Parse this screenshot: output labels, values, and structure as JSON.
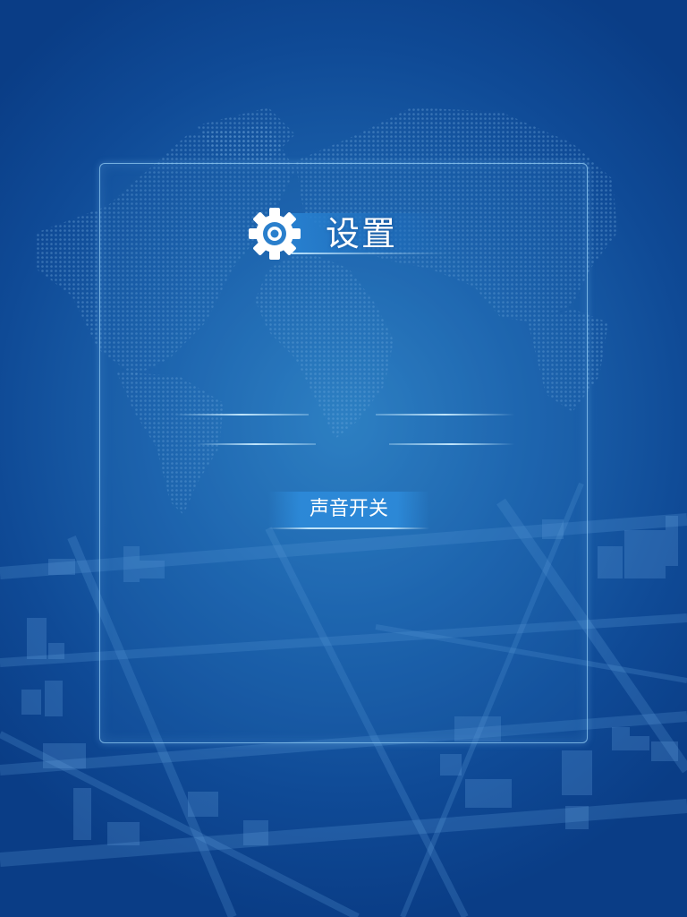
{
  "settings": {
    "title": "设置",
    "icon": "gear-icon",
    "sound_toggle_label": "声音开关"
  },
  "colors": {
    "background": "#1c63ad",
    "panel_border": "#96cdf5",
    "button_fill": "#2d8cdc",
    "text": "#ffffff"
  }
}
